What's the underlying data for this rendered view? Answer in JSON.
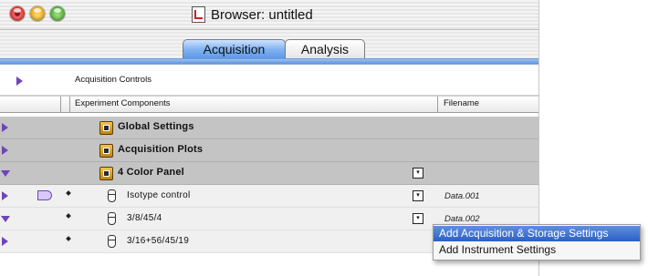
{
  "window": {
    "title": "Browser: untitled"
  },
  "tabs": [
    {
      "label": "Acquisition",
      "selected": true
    },
    {
      "label": "Analysis",
      "selected": false
    }
  ],
  "acquisition_controls": {
    "label": "Acquisition Controls"
  },
  "table": {
    "columns": [
      "Experiment Components",
      "Filename"
    ],
    "rows": [
      {
        "name": "Global Settings",
        "type": "group",
        "expanded": false,
        "filename": ""
      },
      {
        "name": "Acquisition Plots",
        "type": "group",
        "expanded": false,
        "filename": ""
      },
      {
        "name": "4 Color Panel",
        "type": "group",
        "expanded": true,
        "filename": ""
      },
      {
        "name": "Isotype control",
        "type": "tube",
        "expanded": false,
        "filename": "Data.001"
      },
      {
        "name": "3/8/45/4",
        "type": "tube",
        "expanded": true,
        "filename": "Data.002"
      },
      {
        "name": "3/16+56/45/19",
        "type": "tube",
        "expanded": false,
        "filename": ""
      }
    ]
  },
  "context_menu": {
    "items": [
      {
        "label": "Add Acquisition & Storage Settings",
        "highlighted": true
      },
      {
        "label": "Add Instrument Settings",
        "highlighted": false
      }
    ]
  },
  "colors": {
    "accent": "#5b96e6",
    "disclosure": "#6f45b8",
    "menu_highlight": "#2d5fc5"
  }
}
